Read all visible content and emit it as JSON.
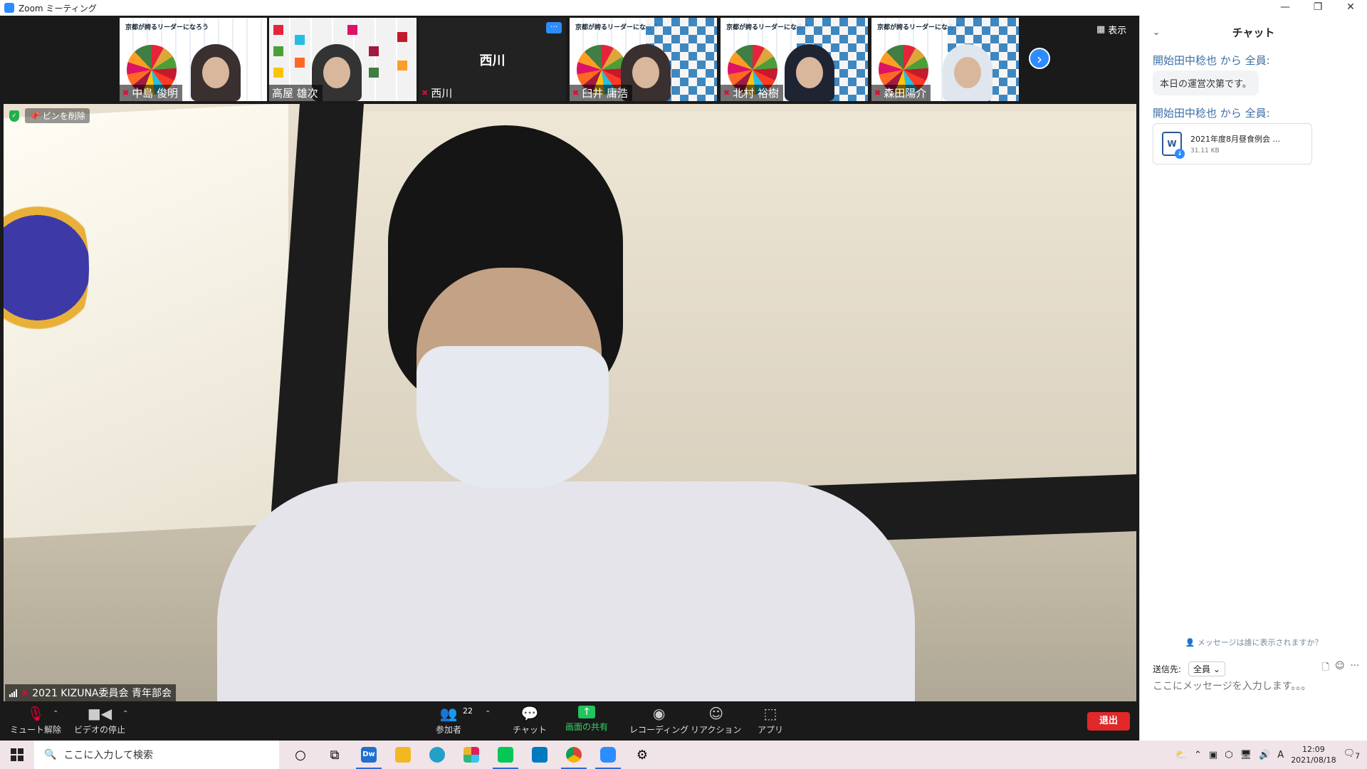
{
  "window": {
    "title": "Zoom ミーティング",
    "controls": [
      "—",
      "❐",
      "✕"
    ]
  },
  "gallery": {
    "tiles": [
      {
        "name": "中島 俊明",
        "poster_title": "京都が誇るリーダーになろう"
      },
      {
        "name": "高屋 雄次"
      },
      {
        "name": "西川",
        "label": "西川"
      },
      {
        "name": "臼井 庸浩",
        "poster_title": "京都が誇るリーダーになろう"
      },
      {
        "name": "北村 裕樹",
        "poster_title": "京都が誇るリーダーになろう"
      },
      {
        "name": "森田陽介",
        "poster_title": "京都が誇るリーダーになろう"
      }
    ],
    "more_label": "···",
    "next_label": "›",
    "view_label": "表示"
  },
  "main_video": {
    "pin_label": "ピンを削除",
    "speaker_name": "2021 KIZUNA委員会 青年部会"
  },
  "toolbar": {
    "mute_label": "ミュート解除",
    "video_label": "ビデオの停止",
    "participants_label": "参加者",
    "participants_count": "22",
    "chat_label": "チャット",
    "share_label": "画面の共有",
    "record_label": "レコーディング",
    "reactions_label": "リアクション",
    "apps_label": "アプリ",
    "leave_label": "退出"
  },
  "chat": {
    "title": "チャット",
    "messages": [
      {
        "prefix": "開始",
        "sender": "田中稔也",
        "middle": " から ",
        "to": "全員",
        "suffix": ":",
        "text": "本日の運営次第です。"
      },
      {
        "prefix": "開始",
        "sender": "田中稔也",
        "middle": " から ",
        "to": "全員",
        "suffix": ":",
        "file_name": "2021年度8月昼食例会 ...",
        "file_size": "31.11 KB",
        "file_icon_letter": "W"
      }
    ],
    "who_sees": "メッセージは誰に表示されますか？",
    "send_to_label": "送信先:",
    "send_to_value": "全員",
    "input_placeholder": "ここにメッセージを入力します。。。"
  },
  "taskbar": {
    "search_placeholder": "ここに入力して検索",
    "ime": "A",
    "time": "12:09",
    "date": "2021/08/18",
    "notif_count": "7"
  },
  "colors": {
    "zoom_blue": "#2d8cff",
    "leave_red": "#e02828",
    "share_green": "#22c55e"
  }
}
